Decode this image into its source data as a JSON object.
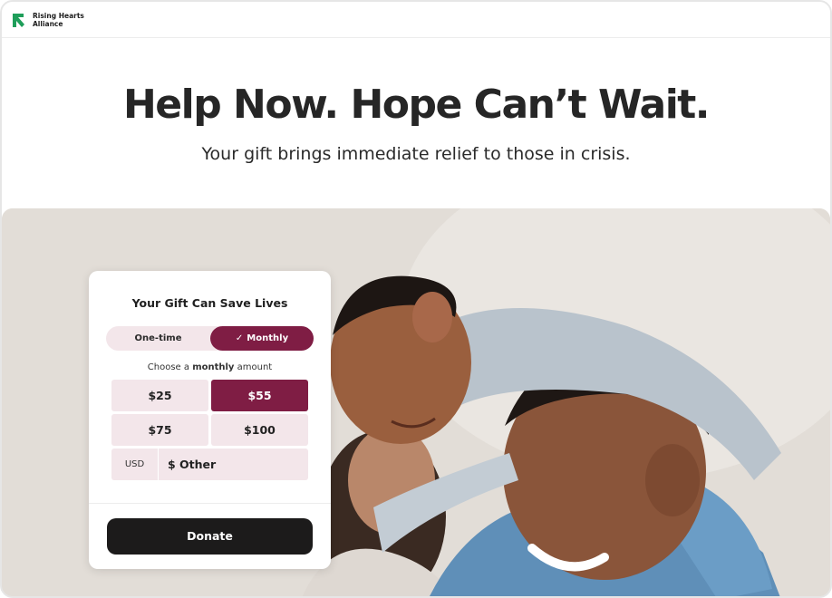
{
  "brand": {
    "name_line1": "Rising Hearts",
    "name_line2": "Alliance",
    "accent_color": "#1f9e5a"
  },
  "hero": {
    "title": "Help Now. Hope Can’t Wait.",
    "subtitle": "Your gift brings immediate relief to those in crisis."
  },
  "card": {
    "title": "Your Gift Can Save Lives",
    "frequency": {
      "options": [
        "One-time",
        "Monthly"
      ],
      "selected": "Monthly",
      "check_icon": "check-icon"
    },
    "choose_prefix": "Choose a",
    "choose_bold": "monthly",
    "choose_suffix": "amount",
    "amounts": [
      "$25",
      "$55",
      "$75",
      "$100"
    ],
    "selected_amount": "$55",
    "other": {
      "currency": "USD",
      "placeholder": "$ Other"
    },
    "donate_label": "Donate",
    "accent_color": "#7f1d44",
    "pill_color": "#f3e6ea"
  }
}
